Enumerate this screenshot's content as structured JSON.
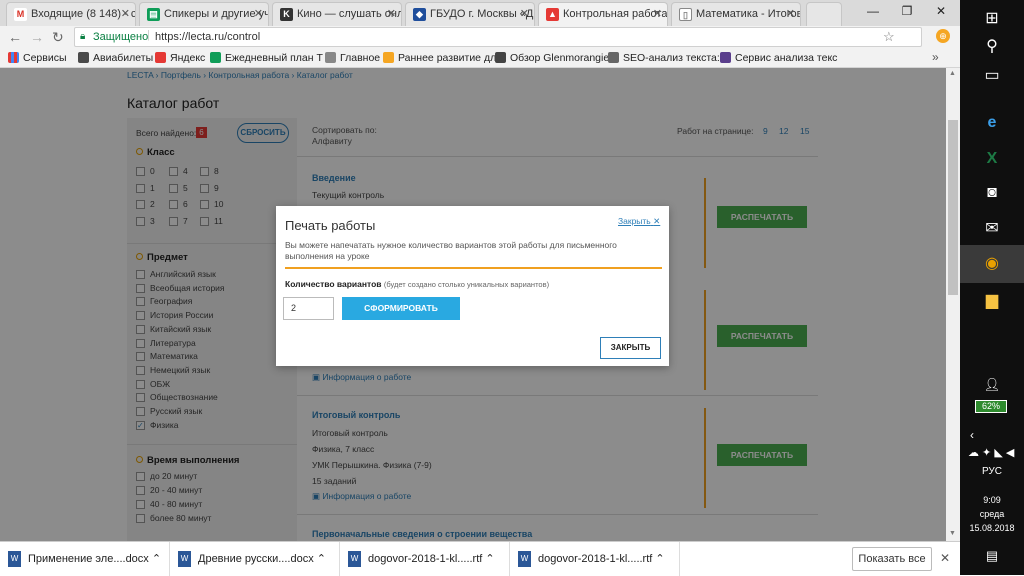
{
  "browser": {
    "tabs": [
      {
        "title": "Входящие (8 148) - сп",
        "icon": "gmail-icon",
        "color": "#d93025",
        "glyph": "M"
      },
      {
        "title": "Спикеры и другие уч",
        "icon": "sheets-icon",
        "color": "#0f9d58",
        "glyph": "▤"
      },
      {
        "title": "Кино — слушать онл",
        "icon": "music-icon",
        "color": "#333333",
        "glyph": "K"
      },
      {
        "title": "ГБУДО г. Москвы «Д",
        "icon": "shield-icon",
        "color": "#1f4e9c",
        "glyph": "◆"
      },
      {
        "title": "Контрольная работа",
        "icon": "lecta-icon",
        "color": "#e53935",
        "glyph": "▲"
      },
      {
        "title": "Математика - Итогов",
        "icon": "page-icon",
        "color": "#888888",
        "glyph": "▯"
      }
    ],
    "security_label": "Защищено",
    "url": "https://lecta.ru/control",
    "bookmarks": [
      {
        "label": "Сервисы",
        "color": "#e53935"
      },
      {
        "label": "Авиабилеты",
        "color": "#4a4a4a"
      },
      {
        "label": "Яндекс",
        "color": "#e53935"
      },
      {
        "label": "Ежедневный план Т",
        "color": "#0f9d58"
      },
      {
        "label": "Главное",
        "color": "#888888"
      },
      {
        "label": "Раннее развитие дл",
        "color": "#f5a623"
      },
      {
        "label": "Обзор Glenmorangie",
        "color": "#444444"
      },
      {
        "label": "SEO-анализ текста: г",
        "color": "#666666"
      },
      {
        "label": "Сервис анализа текс",
        "color": "#5a3e8c"
      }
    ]
  },
  "page": {
    "breadcrumb": "LECTA › Портфель › Контрольная работа › Каталог работ",
    "title": "Каталог работ",
    "found_label": "Всего найдено:",
    "found_count": "6",
    "reset_label": "СБРОСИТЬ",
    "class_label": "Класс",
    "classes": [
      "0",
      "4",
      "8",
      "1",
      "5",
      "9",
      "2",
      "6",
      "10",
      "3",
      "7",
      "11"
    ],
    "subject_label": "Предмет",
    "subjects": [
      "Английский язык",
      "Всеобщая история",
      "География",
      "История России",
      "Китайский язык",
      "Литература",
      "Математика",
      "Немецкий язык",
      "ОБЖ",
      "Обществознание",
      "Русский язык",
      "Физика"
    ],
    "time_label": "Время выполнения",
    "times": [
      "до 20 минут",
      "20 - 40 минут",
      "40 - 80 минут",
      "более 80 минут"
    ],
    "sort_label": "Сортировать по:",
    "sort_value": "Алфавиту",
    "per_page_label": "Работ на странице:",
    "per_page": [
      "9",
      "12",
      "15"
    ],
    "items": [
      {
        "title": "Введение",
        "lines": [
          "Текущий контроль"
        ],
        "info": ""
      },
      {
        "title": "",
        "lines": [],
        "info": "Информация о работе"
      },
      {
        "title": "Итоговый контроль",
        "lines": [
          "Итоговый контроль",
          "Физика, 7 класс",
          "УМК Перышкина. Физика (7-9)",
          "15 заданий"
        ],
        "info": "Информация о работе"
      },
      {
        "title": "Первоначальные сведения о строении вещества",
        "lines": [],
        "info": ""
      }
    ],
    "print_label": "РАСПЕЧАТАТЬ"
  },
  "modal": {
    "title": "Печать работы",
    "close_link": "Закрыть",
    "description": "Вы можете напечатать нужное количество вариантов этой работы для письменного выполнения на уроке",
    "variants_label": "Количество вариантов",
    "variants_hint": "(будет создано столько уникальных вариантов)",
    "variants_value": "2",
    "generate_label": "СФОРМИРОВАТЬ",
    "close_button": "ЗАКРЫТЬ"
  },
  "downloads": {
    "items": [
      "Применение эле....docx",
      "Древние русски....docx",
      "dogovor-2018-1-kl.....rtf",
      "dogovor-2018-1-kl.....rtf"
    ],
    "show_all": "Показать все"
  },
  "taskbar": {
    "battery": "62%",
    "lang": "РУС",
    "time": "9:09",
    "day": "среда",
    "date": "15.08.2018"
  }
}
